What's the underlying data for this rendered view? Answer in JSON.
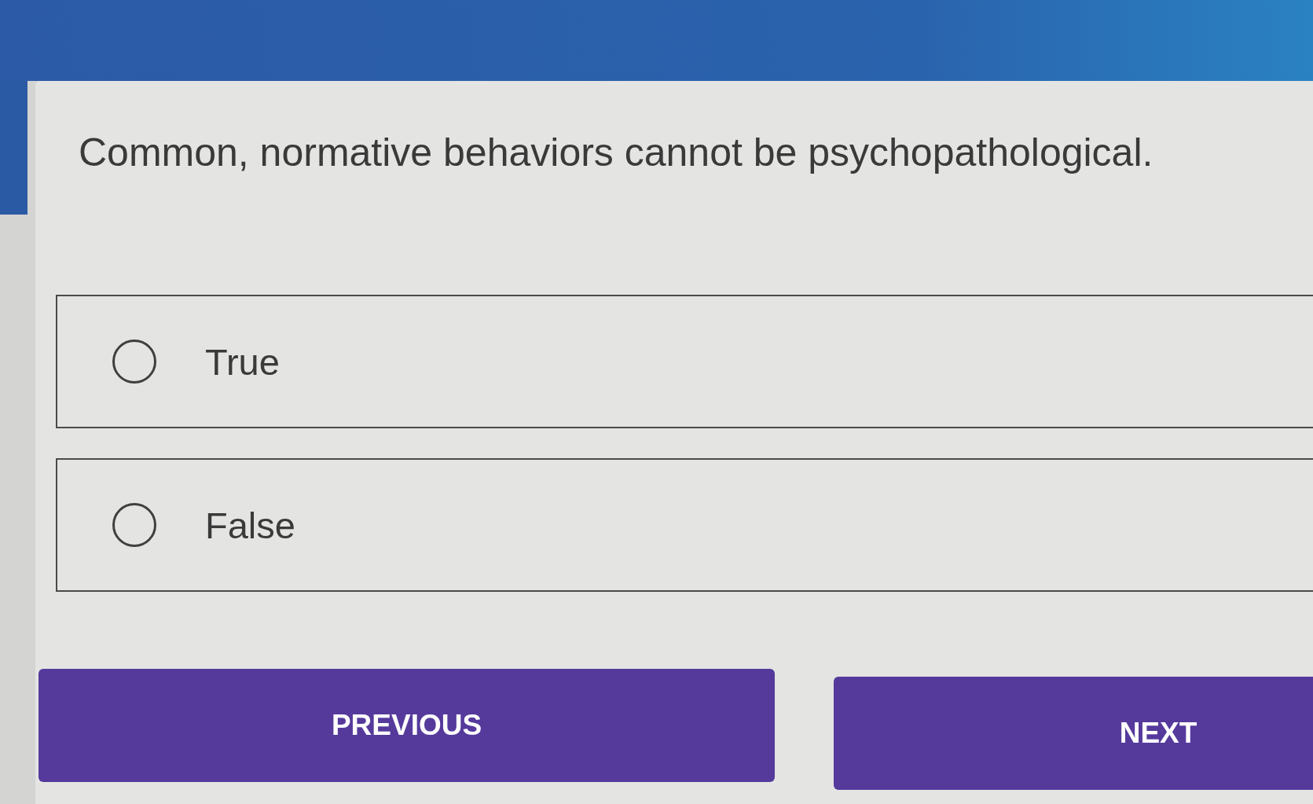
{
  "question": {
    "text": "Common, normative behaviors cannot be psychopathological."
  },
  "options": [
    {
      "label": "True",
      "selected": false
    },
    {
      "label": "False",
      "selected": false
    }
  ],
  "buttons": [
    "PREVIOUS",
    "NEXT"
  ]
}
